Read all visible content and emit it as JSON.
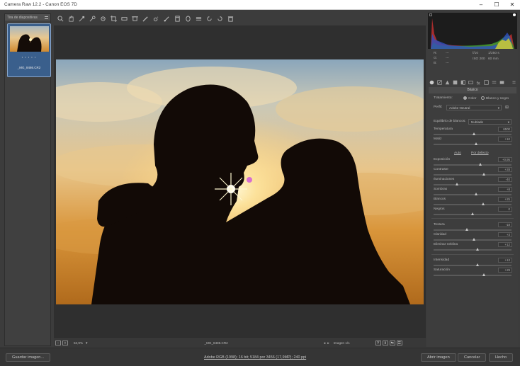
{
  "window": {
    "title": "Camera Raw 12.2  -  Canon EOS 7D"
  },
  "filmstrip": {
    "title": "Tira de diapositivas",
    "thumbnail_stars": "• • • • •",
    "thumbnail_name": "_MG_8486.CR2"
  },
  "toolbar": {
    "icons": [
      "zoom-icon",
      "hand-icon",
      "white-balance-icon",
      "color-sampler-icon",
      "target-adjust-icon",
      "crop-icon",
      "straighten-icon",
      "transform-icon",
      "spot-removal-icon",
      "red-eye-icon",
      "adjustment-brush-icon",
      "graduated-filter-icon",
      "radial-filter-icon",
      "preferences-icon",
      "rotate-left-icon",
      "rotate-right-icon",
      "trash-icon"
    ]
  },
  "histogram_info": {
    "rgb_labels": [
      "R:",
      "G:",
      "B:"
    ],
    "rgb_values": [
      "---",
      "---",
      "---"
    ],
    "aperture": "f/10",
    "shutter": "1/250 s",
    "iso": "ISO 200",
    "focal": "60 mm"
  },
  "panel": {
    "title": "Básico",
    "treatment_label": "Tratamiento:",
    "treatment_color": "Color",
    "treatment_bw": "Blanco y negro",
    "profile_label": "Perfil:",
    "profile_value": "Adobe Neutral",
    "wb_label": "Equilibrio de blancos:",
    "wb_value": "Nublado",
    "auto_link": "Auto",
    "default_link": "Por defecto",
    "controls": [
      {
        "label": "Temperatura",
        "value": "6500"
      },
      {
        "label": "Matiz",
        "value": "+10"
      },
      {
        "label": "Exposición",
        "value": "+0,95"
      },
      {
        "label": "Contraste",
        "value": "+28"
      },
      {
        "label": "Iluminaciones",
        "value": "-40"
      },
      {
        "label": "Sombras",
        "value": "+8"
      },
      {
        "label": "Blancos",
        "value": "+25"
      },
      {
        "label": "Negros",
        "value": "0"
      },
      {
        "label": "Textura",
        "value": "-18"
      },
      {
        "label": "Claridad",
        "value": "+3"
      },
      {
        "label": "Eliminar neblina",
        "value": "+12"
      },
      {
        "label": "Intensidad",
        "value": "+13"
      },
      {
        "label": "Saturación",
        "value": "+29"
      }
    ]
  },
  "statusbar": {
    "zoom": "52,9%",
    "filename": "_MG_8486.CR2",
    "image_count": "Imagen 1/1"
  },
  "bottombar": {
    "save_button": "Guardar imagen...",
    "workflow_link": "Adobe RGB (1998); 16 bit; 5184 por 3456 (17,9MP); 240 ppi",
    "open_button": "Abrir imagen",
    "cancel_button": "Cancelar",
    "done_button": "Hecho"
  },
  "colors": {
    "accent": "#3a5f8c",
    "panel_bg": "#3d3d3d",
    "canvas_bg": "#2f2f2f"
  }
}
